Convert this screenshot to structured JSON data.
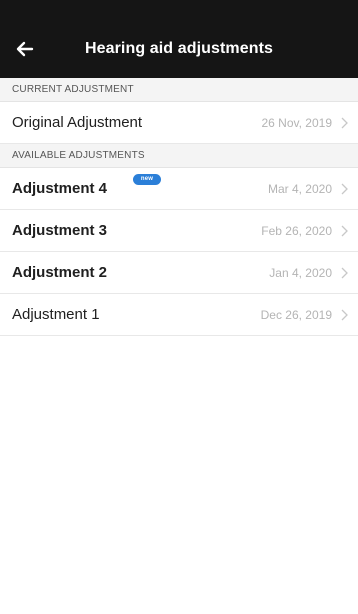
{
  "header": {
    "title": "Hearing aid adjustments",
    "back_icon": "arrow-left-icon"
  },
  "sections": {
    "current": {
      "title": "CURRENT ADJUSTMENT",
      "item": {
        "label": "Original Adjustment",
        "date": "26 Nov, 2019"
      }
    },
    "available": {
      "title": "AVAILABLE ADJUSTMENTS",
      "items": [
        {
          "label": "Adjustment 4",
          "date": "Mar 4, 2020",
          "badge": "new"
        },
        {
          "label": "Adjustment 3",
          "date": "Feb 26, 2020"
        },
        {
          "label": "Adjustment 2",
          "date": "Jan 4, 2020"
        },
        {
          "label": "Adjustment 1",
          "date": "Dec 26, 2019"
        }
      ]
    }
  },
  "colors": {
    "header_bg": "#151515",
    "badge_bg": "#2b7fd8",
    "section_bg": "#f4f4f4",
    "date_text": "#b4b4b4"
  }
}
